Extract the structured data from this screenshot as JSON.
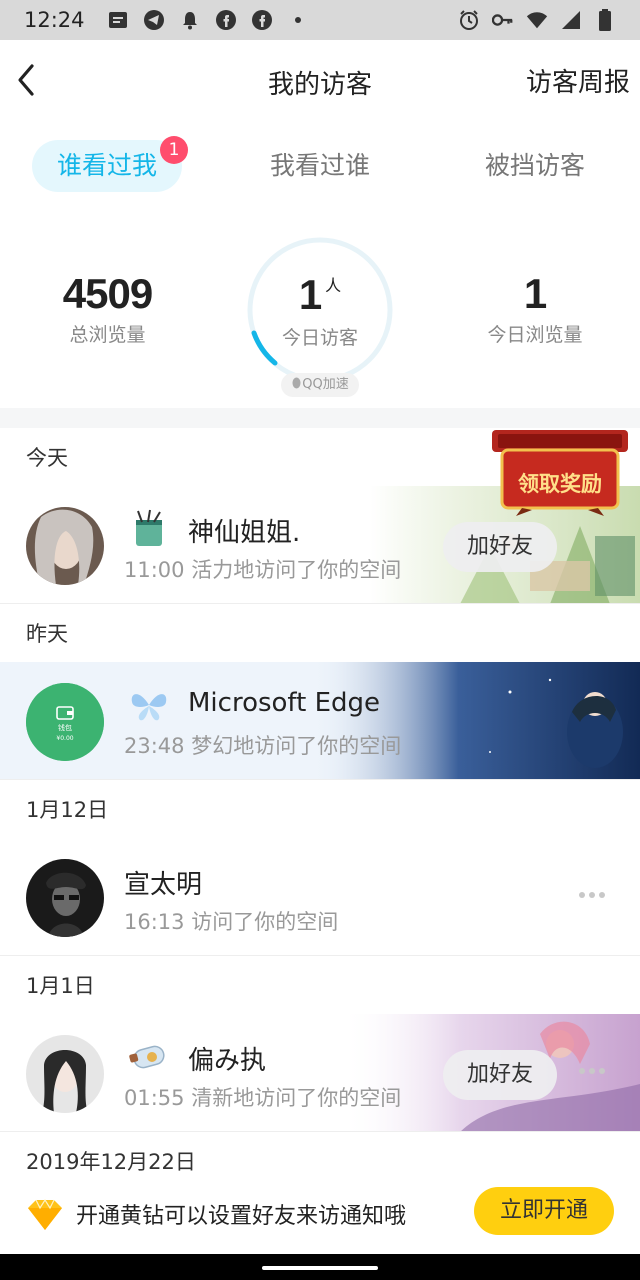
{
  "status_bar": {
    "time": "12:24",
    "icons_left": [
      "message-icon",
      "telegram-icon",
      "bell-icon",
      "facebook-icon",
      "facebook-icon",
      "dot-icon"
    ],
    "icons_right": [
      "alarm-icon",
      "key-icon",
      "wifi-icon",
      "signal-icon",
      "battery-icon"
    ]
  },
  "header": {
    "title": "我的访客",
    "right_link": "访客周报"
  },
  "tabs": [
    {
      "label": "谁看过我",
      "badge": "1",
      "active": true
    },
    {
      "label": "我看过谁"
    },
    {
      "label": "被挡访客"
    }
  ],
  "stats": {
    "total_views": {
      "value": "4509",
      "label": "总浏览量"
    },
    "today_visitors": {
      "value": "1",
      "unit": "人",
      "label": "今日访客",
      "pill": "QQ加速"
    },
    "today_views": {
      "value": "1",
      "label": "今日浏览量"
    }
  },
  "promo_banner": {
    "label": "领取奖励"
  },
  "sections": [
    {
      "label": "今天",
      "visitors": [
        {
          "name": "神仙姐姐.",
          "time": "11:00",
          "action": "活力地访问了你的空间",
          "button": "加好友"
        }
      ]
    },
    {
      "label": "昨天",
      "visitors": [
        {
          "name": "Microsoft Edge",
          "time": "23:48",
          "action": "梦幻地访问了你的空间",
          "wallet_label": "钱包",
          "wallet_amount": "¥0.00"
        }
      ]
    },
    {
      "label": "1月12日",
      "visitors": [
        {
          "name": "宣太明",
          "time": "16:13",
          "action": "访问了你的空间"
        }
      ]
    },
    {
      "label": "1月1日",
      "visitors": [
        {
          "name": "偏み执",
          "time": "01:55",
          "action": "清新地访问了你的空间",
          "button": "加好友"
        }
      ]
    },
    {
      "label": "2019年12月22日"
    }
  ],
  "bottom_bar": {
    "text": "开通黄钻可以设置好友来访通知哦",
    "button": "立即开通"
  },
  "colors": {
    "accent": "#14b6e8",
    "badge": "#ff4d6d",
    "vip_button": "#ffcf0f",
    "wallet_green": "#3cb371"
  }
}
